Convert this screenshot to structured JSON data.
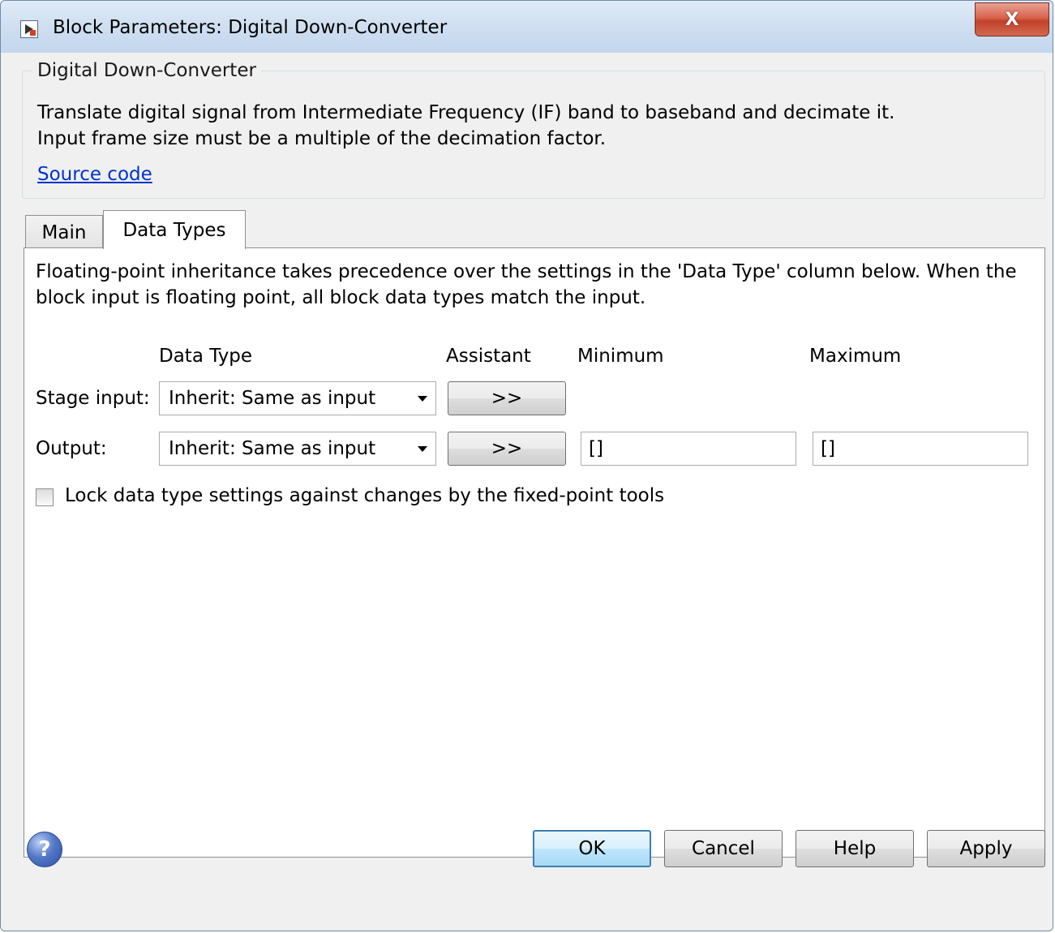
{
  "window": {
    "title": "Block Parameters: Digital Down-Converter",
    "close_glyph": "X"
  },
  "description": {
    "group_title": "Digital Down-Converter",
    "line1": "Translate digital signal from Intermediate Frequency (IF) band to baseband and decimate it.",
    "line2": "Input frame size must be a multiple of the decimation factor.",
    "link": "Source code"
  },
  "tabs": [
    {
      "label": "Main",
      "active": false
    },
    {
      "label": "Data Types",
      "active": true
    }
  ],
  "data_types": {
    "info_line1": "Floating-point inheritance takes precedence over the settings in the 'Data Type' column below. When the",
    "info_line2": "block input is floating point, all block data types match the input.",
    "headers": {
      "data_type": "Data Type",
      "assistant": "Assistant",
      "minimum": "Minimum",
      "maximum": "Maximum"
    },
    "rows": [
      {
        "label": "Stage input:",
        "data_type": "Inherit: Same as input",
        "assistant": ">>"
      },
      {
        "label": "Output:",
        "data_type": "Inherit: Same as input",
        "assistant": ">>",
        "minimum": "[]",
        "maximum": "[]"
      }
    ],
    "lock_checkbox": {
      "label": "Lock data type settings against changes by the fixed-point tools",
      "checked": false
    }
  },
  "buttons": {
    "help_icon_glyph": "?",
    "ok": "OK",
    "cancel": "Cancel",
    "help": "Help",
    "apply": "Apply"
  },
  "colors": {
    "link": "#0033cc",
    "close_button": "#c2412a",
    "default_button_border": "#3c7fb1"
  }
}
